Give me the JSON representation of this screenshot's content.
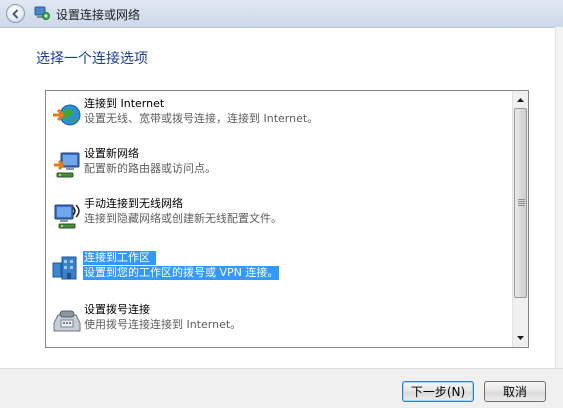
{
  "window": {
    "title": "设置连接或网络"
  },
  "main": {
    "heading": "选择一个连接选项"
  },
  "options": [
    {
      "title": "连接到 Internet",
      "description": "设置无线、宽带或拨号连接，连接到 Internet。",
      "icon": "internet-globe-icon",
      "selected": false
    },
    {
      "title": "设置新网络",
      "description": "配置新的路由器或访问点。",
      "icon": "new-network-icon",
      "selected": false
    },
    {
      "title": "手动连接到无线网络",
      "description": "连接到隐藏网络或创建新无线配置文件。",
      "icon": "wireless-network-icon",
      "selected": false
    },
    {
      "title": "连接到工作区",
      "description": "设置到您的工作区的拨号或 VPN 连接。",
      "icon": "workplace-icon",
      "selected": true
    },
    {
      "title": "设置拨号连接",
      "description": "使用拨号连接连接到 Internet。",
      "icon": "dialup-modem-icon",
      "selected": false
    }
  ],
  "buttons": {
    "next": "下一步(N)",
    "cancel": "取消"
  },
  "colors": {
    "heading": "#1c3f95",
    "selection": "#3399ff"
  }
}
